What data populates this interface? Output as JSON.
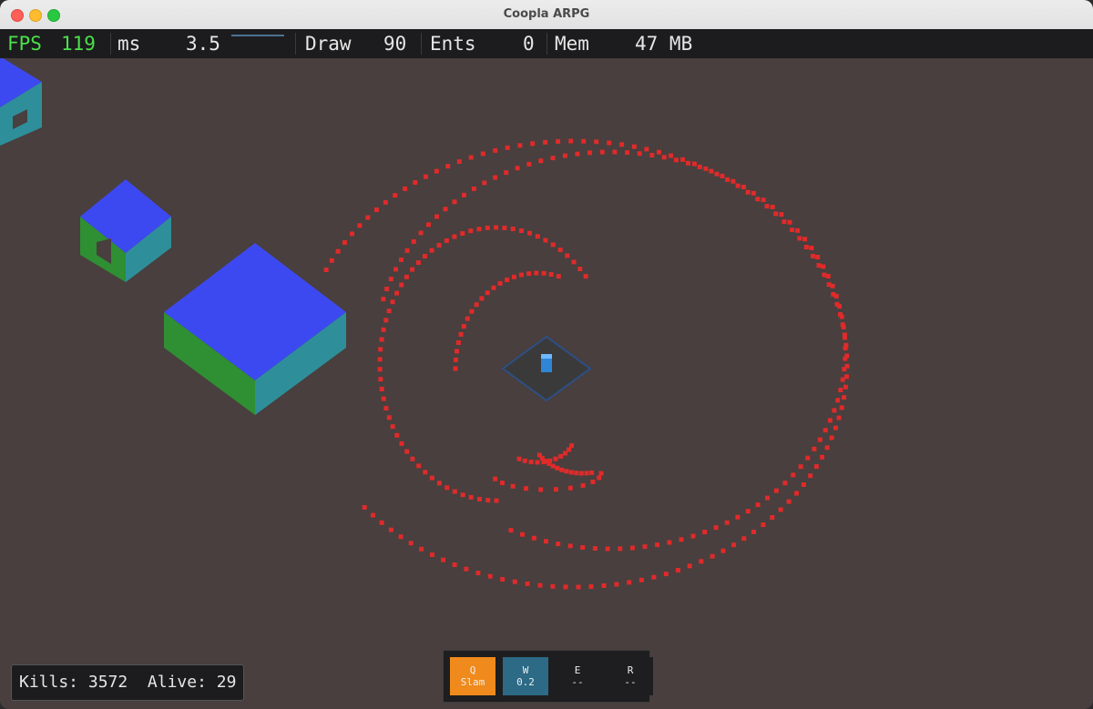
{
  "window": {
    "title": "Coopla ARPG"
  },
  "hud": {
    "fps_label": "FPS",
    "fps_value": "119",
    "ms_label": "ms",
    "ms_value": "3.5",
    "draw_label": "Draw",
    "draw_value": "90",
    "ents_label": "Ents",
    "ents_value": "0",
    "mem_label": "Mem",
    "mem_value": "47 MB"
  },
  "stats": {
    "kills_text": "Kills: 3572",
    "alive_text": "Alive: 29"
  },
  "skills": [
    {
      "key": "Q",
      "label": "Slam",
      "color": "#f08a1c"
    },
    {
      "key": "W",
      "label": "0.2",
      "color": "#2c6a86"
    },
    {
      "key": "E",
      "label": "--",
      "color": "#1e1e20"
    },
    {
      "key": "R",
      "label": "--",
      "color": "#1e1e20"
    }
  ],
  "colors": {
    "ground": "#483f3e",
    "enemy": "#e02a2a",
    "block_top": "#3d49f0",
    "block_left": "#2f8f33",
    "block_right": "#2e8f9a",
    "player": "#2f86d6"
  }
}
